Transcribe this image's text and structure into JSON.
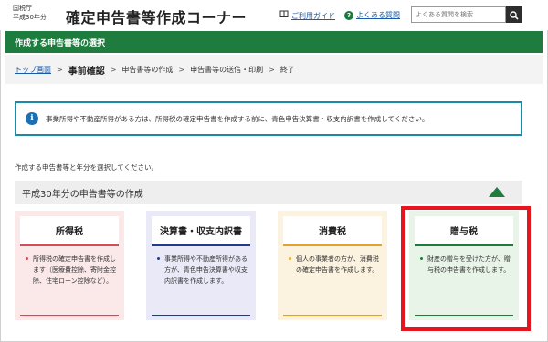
{
  "header": {
    "agency_line1": "国税庁",
    "agency_line2": "平成30年分",
    "title": "確定申告書等作成コーナー",
    "guide_link": "ご利用ガイド",
    "faq_link": "よくある質問",
    "search_placeholder": "よくある質問を検索"
  },
  "greenbar": {
    "title": "作成する申告書等の選択"
  },
  "breadcrumb": {
    "items": [
      "トップ画面",
      "事前確認",
      "申告書等の作成",
      "申告書等の送信・印刷",
      "終了"
    ]
  },
  "info": {
    "message": "事業所得や不動産所得がある方は、所得税の確定申告書を作成する前に、青色申告決算書・収支内訳書を作成してください。"
  },
  "instruction": "作成する申告書等と年分を選択してください。",
  "section": {
    "title": "平成30年分の申告書等の作成"
  },
  "cards": [
    {
      "title": "所得税",
      "text": "所得税の確定申告書を作成します（医療費控除、寄附金控除、住宅ローン控除など）。",
      "color": "#d14e56"
    },
    {
      "title": "決算書・収支内訳書",
      "text": "事業所得や不動産所得がある方が、青色申告決算書や収支内訳書を作成します。",
      "color": "#233c8a"
    },
    {
      "title": "消費税",
      "text": "個人の事業者の方が、消費税の確定申告書を作成します。",
      "color": "#e0a42b"
    },
    {
      "title": "贈与税",
      "text": "財産の贈与を受けた方が、贈与税の申告書を作成します。",
      "color": "#1e7c3f"
    }
  ],
  "icons": {
    "guide": "book-icon",
    "faq": "question-icon",
    "search": "search-icon",
    "info": "info-icon",
    "collapse": "triangle-up-icon"
  },
  "colors": {
    "brand_green": "#1e7c3f",
    "highlight_red": "#e8141e",
    "link_blue": "#1a5aa6"
  }
}
